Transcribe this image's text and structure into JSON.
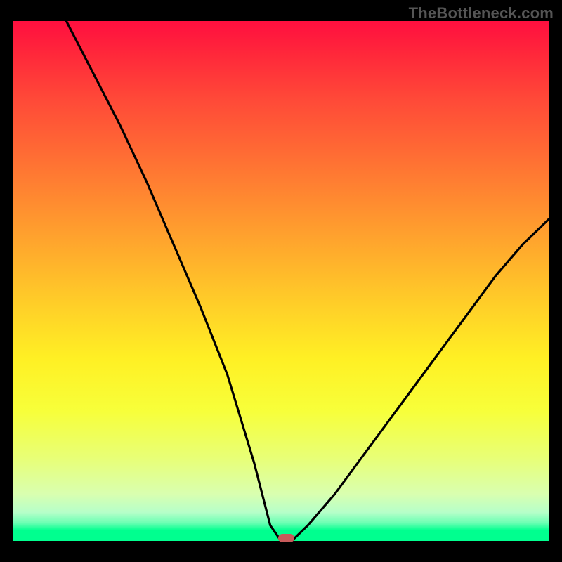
{
  "watermark": "TheBottleneck.com",
  "chart_data": {
    "type": "line",
    "title": "",
    "xlabel": "",
    "ylabel": "",
    "x_range": [
      0,
      100
    ],
    "y_range": [
      0,
      100
    ],
    "grid": false,
    "legend": false,
    "series": [
      {
        "name": "curve",
        "x": [
          10,
          15,
          20,
          25,
          30,
          35,
          40,
          45,
          48,
          50,
          52,
          55,
          60,
          65,
          70,
          75,
          80,
          85,
          90,
          95,
          100
        ],
        "y": [
          100,
          90,
          80,
          69,
          57,
          45,
          32,
          15,
          3,
          0,
          0,
          3,
          9,
          16,
          23,
          30,
          37,
          44,
          51,
          57,
          62
        ]
      }
    ],
    "marker": {
      "x": 51,
      "y": 0,
      "color": "#c75a5a",
      "shape": "capsule"
    },
    "background_gradient": {
      "direction": "vertical",
      "stops": [
        {
          "pos": 0,
          "color": "#ff0f3f"
        },
        {
          "pos": 50,
          "color": "#ffd028"
        },
        {
          "pos": 75,
          "color": "#f7ff3a"
        },
        {
          "pos": 100,
          "color": "#00ff8f"
        }
      ]
    }
  }
}
